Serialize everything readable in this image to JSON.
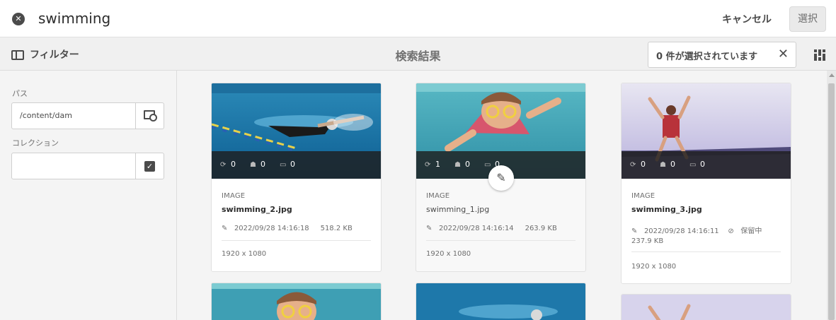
{
  "header": {
    "search_query": "swimming",
    "cancel_label": "キャンセル",
    "select_label": "選択"
  },
  "toolbar": {
    "filter_label": "フィルター",
    "results_title": "検索結果",
    "selection_status": "0 件が選択されています"
  },
  "sidebar": {
    "path_label": "パス",
    "path_value": "/content/dam",
    "collection_label": "コレクション",
    "collection_value": ""
  },
  "cards": [
    {
      "type": "IMAGE",
      "filename": "swimming_2.jpg",
      "date": "2022/09/28 14:16:18",
      "size": "518.2 KB",
      "status": "",
      "dimensions": "1920 x 1080",
      "stats": [
        "0",
        "0",
        "0"
      ]
    },
    {
      "type": "IMAGE",
      "filename": "swimming_1.jpg",
      "date": "2022/09/28 14:16:14",
      "size": "263.9 KB",
      "status": "",
      "dimensions": "1920 x 1080",
      "stats": [
        "1",
        "0",
        "0"
      ]
    },
    {
      "type": "IMAGE",
      "filename": "swimming_3.jpg",
      "date": "2022/09/28 14:16:11",
      "size": "237.9 KB",
      "status": "保留中",
      "dimensions": "1920 x 1080",
      "stats": [
        "0",
        "0",
        "0"
      ]
    }
  ],
  "icons": {
    "close": "close-circle-icon",
    "filter": "sidebar-panel-icon",
    "view": "grid-view-icon",
    "path_browse": "folder-search-icon",
    "collection_select": "checkbox-icon",
    "stat_versions": "sync-icon",
    "stat_reviewers": "people-icon",
    "stat_comments": "comment-icon",
    "edit": "brush-icon",
    "pending": "hidden-icon"
  }
}
